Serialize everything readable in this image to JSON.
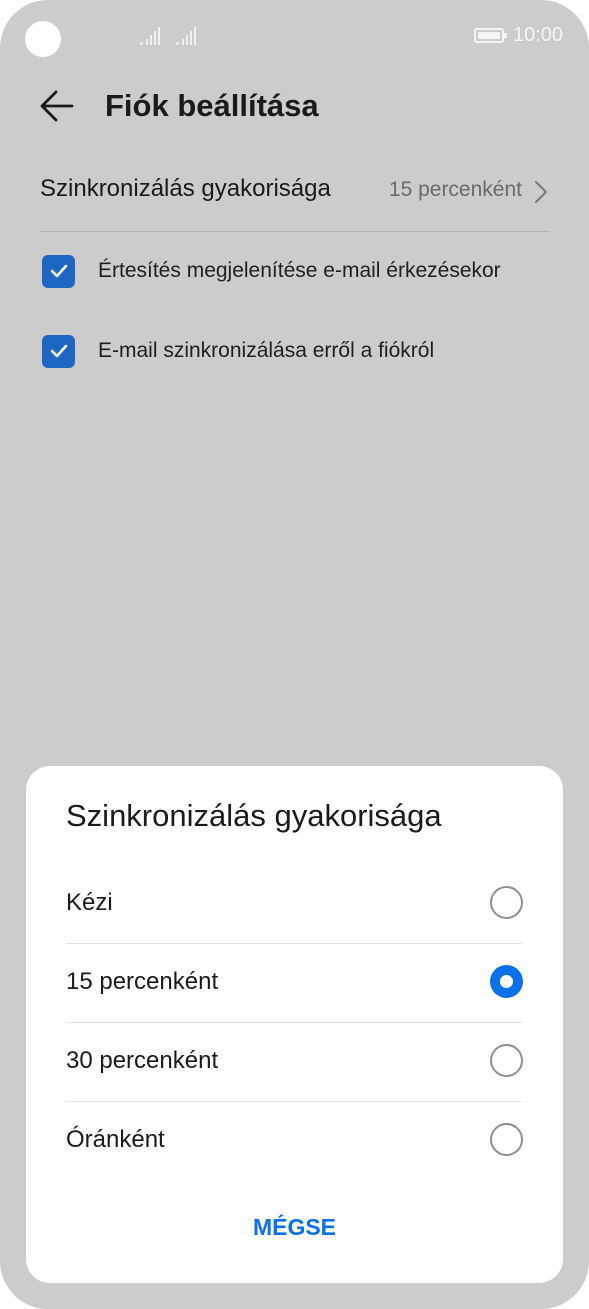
{
  "status_bar": {
    "time": "10:00",
    "icons": [
      "camera-cutout",
      "signal-icon",
      "signal-icon",
      "battery-icon"
    ]
  },
  "header": {
    "title": "Fiók beállítása",
    "back_icon": "arrow-left-icon"
  },
  "settings": {
    "sync_frequency": {
      "label": "Szinkronizálás gyakorisága",
      "value": "15 percenként",
      "icon": "chevron-right-icon"
    },
    "checkboxes": [
      {
        "label": "Értesítés megjelenítése e-mail érkezésekor",
        "checked": true
      },
      {
        "label": "E-mail szinkronizálása erről a fiókról",
        "checked": true
      }
    ]
  },
  "dialog": {
    "title": "Szinkronizálás gyakorisága",
    "options": [
      {
        "label": "Kézi",
        "selected": false
      },
      {
        "label": "15 percenként",
        "selected": true
      },
      {
        "label": "30 percenként",
        "selected": false
      },
      {
        "label": "Óránként",
        "selected": false
      }
    ],
    "cancel_label": "MÉGSE"
  },
  "colors": {
    "background_dim": "#cccccc",
    "accent": "#0a72e6",
    "checkbox": "#1d66c4",
    "dialog_bg": "#ffffff"
  }
}
